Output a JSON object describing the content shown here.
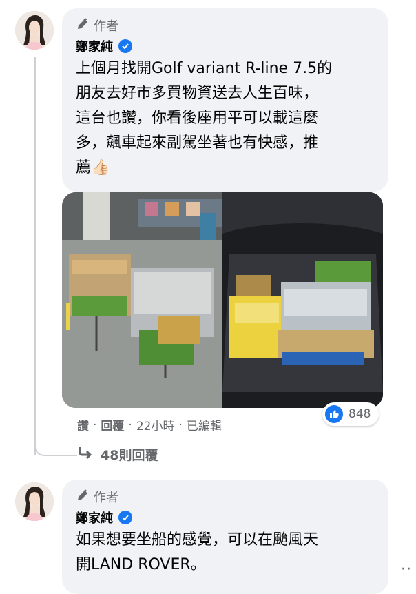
{
  "comment1": {
    "author_badge": "作者",
    "name": "鄭家純",
    "text_lines": [
      "上個月找開Golf variant R-line 7.5的",
      "朋友去好市多買物資送去人生百味，",
      "這台也讚，你看後座用平可以載這麼",
      "多，飆車起來副駕坐著也有快感，推",
      "薦👍🏻"
    ],
    "actions": {
      "like": "讚",
      "sep1": "·",
      "reply": "回覆",
      "sep2": "·",
      "time": "22小時",
      "sep3": "·",
      "edited": "已編輯"
    },
    "reaction_count": "848",
    "replies_label": "48則回覆"
  },
  "comment2": {
    "author_badge": "作者",
    "name": "鄭家純",
    "text_lines": [
      "如果想要坐船的感覺，可以在颱風天",
      "開LAND ROVER。"
    ]
  },
  "more_menu": "··",
  "colors": {
    "bubble": "#f0f2f5",
    "meta_gray": "#65676b",
    "facebook_blue": "#1877f2",
    "thread_line": "#ced0d4"
  },
  "icons": {
    "badge": "pen-icon",
    "verified": "verified-badge-icon",
    "reaction": "like-reaction-icon",
    "replies": "reply-arrow-icon"
  }
}
